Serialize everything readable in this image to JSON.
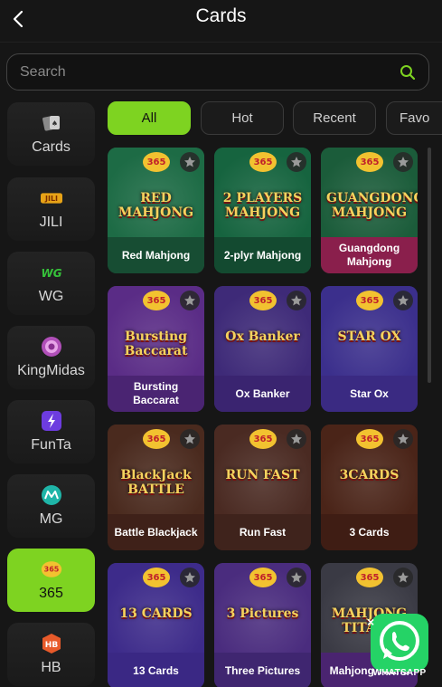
{
  "header": {
    "title": "Cards",
    "back_icon": "chevron-left-icon"
  },
  "search": {
    "placeholder": "Search",
    "icon": "search-icon",
    "accent": "#7ed321"
  },
  "sidebar": {
    "items": [
      {
        "label": "Cards",
        "icon": "playing-cards-icon"
      },
      {
        "label": "JILI",
        "icon": "jili-logo-icon"
      },
      {
        "label": "WG",
        "icon": "wg-logo-icon"
      },
      {
        "label": "KingMidas",
        "icon": "kingmidas-chip-icon"
      },
      {
        "label": "FunTa",
        "icon": "funta-logo-icon"
      },
      {
        "label": "MG",
        "icon": "mg-logo-icon"
      },
      {
        "label": "365",
        "icon": "365-games-logo-icon",
        "active": true
      },
      {
        "label": "HB",
        "icon": "hb-logo-icon"
      }
    ]
  },
  "tabs": [
    {
      "label": "All",
      "active": true
    },
    {
      "label": "Hot"
    },
    {
      "label": "Recent"
    },
    {
      "label": "Favo"
    }
  ],
  "games": [
    {
      "name": "Red Mahjong",
      "logo": "RED MAHJONG",
      "bg": "#1d6b45",
      "name_bg": "#174d33"
    },
    {
      "name": "2-plyr Mahjong",
      "logo": "2 PLAYERS MAHJONG",
      "bg": "#16643f",
      "name_bg": "#134a30"
    },
    {
      "name": "Guangdong Mahjong",
      "logo": "GUANGDONG MAHJONG",
      "bg": "#1b5c3a",
      "name_bg": "#8a1f4c"
    },
    {
      "name": "Bursting Baccarat",
      "logo": "Bursting Baccarat",
      "bg": "#5a2c86",
      "name_bg": "#4a2472"
    },
    {
      "name": "Ox Banker",
      "logo": "Ox Banker",
      "bg": "#3e2a78",
      "name_bg": "#3a2470"
    },
    {
      "name": "Star Ox",
      "logo": "STAR OX",
      "bg": "#3b2f8c",
      "name_bg": "#3a2a82"
    },
    {
      "name": "Battle Blackjack",
      "logo": "BlackJack BATTLE",
      "bg": "#4a2a1e",
      "name_bg": "#3f2119"
    },
    {
      "name": "Run Fast",
      "logo": "RUN FAST",
      "bg": "#4a2a22",
      "name_bg": "#3f231c"
    },
    {
      "name": "3 Cards",
      "logo": "3CARDS",
      "bg": "#4a2418",
      "name_bg": "#3f1d14"
    },
    {
      "name": "13 Cards",
      "logo": "13 CARDS",
      "bg": "#3d2b8a",
      "name_bg": "#3a2884"
    },
    {
      "name": "Three Pictures",
      "logo": "3 Pictures",
      "bg": "#4a2c7e",
      "name_bg": "#3f2670"
    },
    {
      "name": "Mahjong Titans",
      "logo": "MAHJONG TITANS",
      "bg": "#3a3a44",
      "name_bg": "#4a2470"
    }
  ],
  "badge_text": "365",
  "whatsapp": {
    "label": "WHATSAPP",
    "close": "×"
  },
  "colors": {
    "accent": "#7ed321",
    "background": "#161616"
  }
}
